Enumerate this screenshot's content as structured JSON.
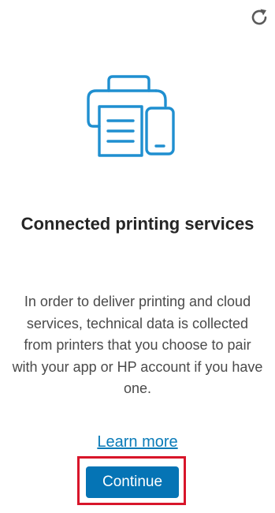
{
  "header": {
    "refresh_icon": "refresh-icon"
  },
  "hero": {
    "icon": "printer-and-phone-icon",
    "accent_color": "#1f8fd0"
  },
  "content": {
    "title": "Connected printing services",
    "description": "In order to deliver printing and cloud services, technical data is collected from printers that you choose to pair with your app or HP account if you have one."
  },
  "actions": {
    "learn_more_label": "Learn more",
    "continue_label": "Continue",
    "primary_color": "#0574b5",
    "highlight_color": "#d8152a"
  }
}
